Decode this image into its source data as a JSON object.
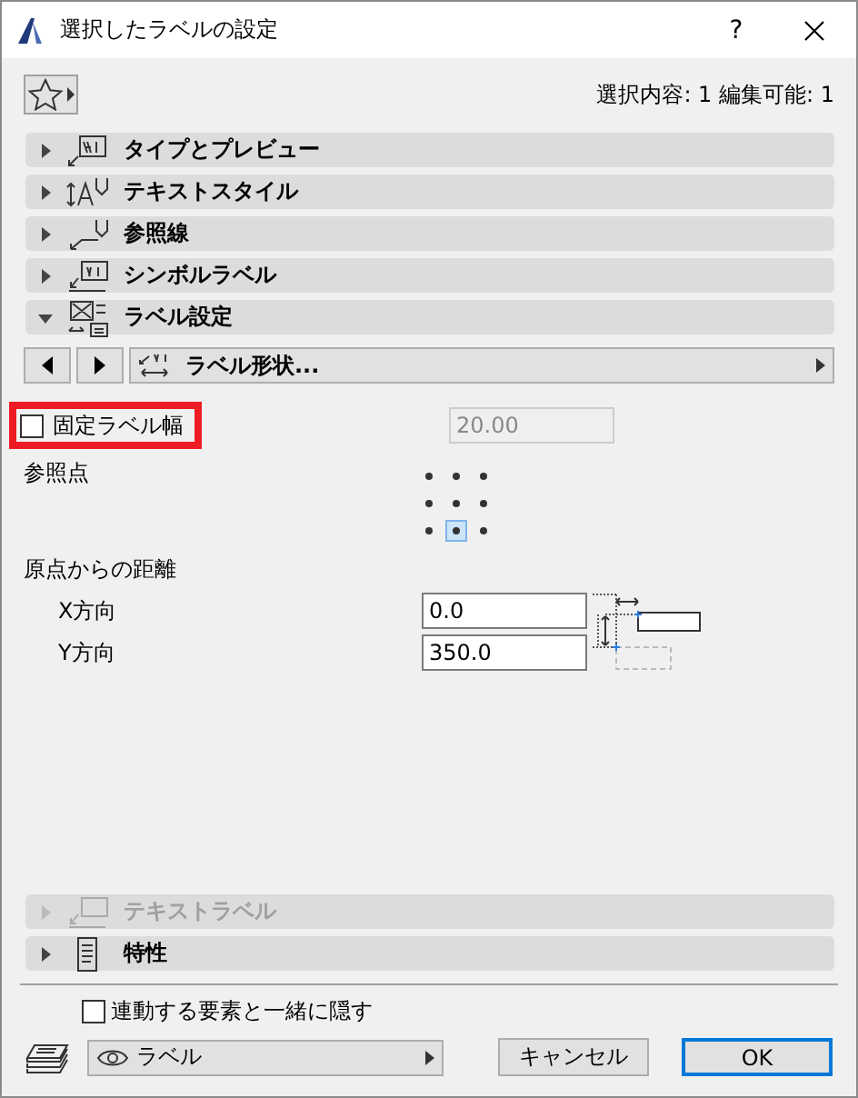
{
  "window": {
    "title": "選択したラベルの設定",
    "help": "?"
  },
  "toolbar": {
    "selection_info": "選択内容: 1 編集可能: 1"
  },
  "sections_top": [
    {
      "kind": "type_preview",
      "label": "タイプとプレビュー",
      "expanded": false,
      "disabled": false
    },
    {
      "kind": "text_style",
      "label": "テキストスタイル",
      "expanded": false,
      "disabled": false
    },
    {
      "kind": "pointer",
      "label": "参照線",
      "expanded": false,
      "disabled": false
    },
    {
      "kind": "symbol",
      "label": "シンボルラベル",
      "expanded": false,
      "disabled": false
    },
    {
      "kind": "settings",
      "label": "ラベル設定",
      "expanded": true,
      "disabled": false
    }
  ],
  "label_settings": {
    "shape_button": "ラベル形状...",
    "fixed_width": {
      "label": "固定ラベル幅",
      "checked": false,
      "highlighted": true,
      "value": "20.00"
    },
    "anchor_label": "参照点",
    "anchors": [
      {
        "selected": false
      },
      {
        "selected": false
      },
      {
        "selected": false
      },
      {
        "selected": false
      },
      {
        "selected": false
      },
      {
        "selected": false
      },
      {
        "selected": false
      },
      {
        "selected": true
      },
      {
        "selected": false
      }
    ],
    "offset_label": "原点からの距離",
    "offsets": [
      {
        "label": "X方向",
        "value": "0.0"
      },
      {
        "label": "Y方向",
        "value": "350.0"
      }
    ]
  },
  "sections_bottom": [
    {
      "kind": "text_label",
      "label": "テキストラベル",
      "expanded": false,
      "disabled": true
    },
    {
      "kind": "properties",
      "label": "特性",
      "expanded": false,
      "disabled": false
    }
  ],
  "footer": {
    "hide_with_linked": {
      "label": "連動する要素と一緒に隠す",
      "checked": false
    },
    "layer": "ラベル",
    "buttons": [
      {
        "label": "キャンセル",
        "default": false
      },
      {
        "label": "OK",
        "default": true
      }
    ]
  }
}
